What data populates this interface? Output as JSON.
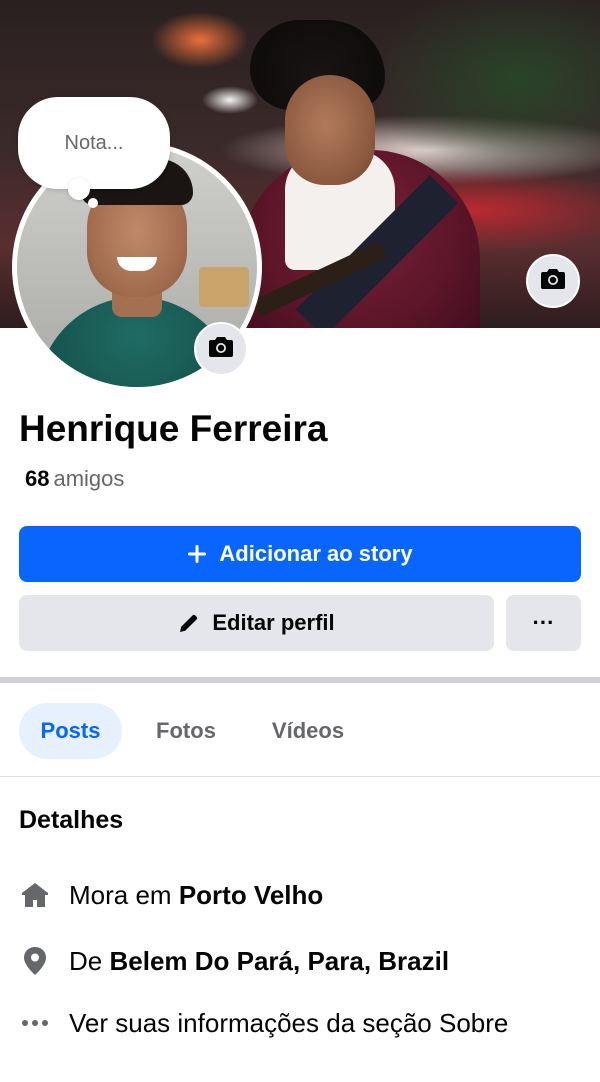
{
  "cover": {
    "camera_icon": "camera-icon"
  },
  "note": {
    "placeholder": "Nota..."
  },
  "profile": {
    "name": "Henrique Ferreira",
    "friends_count": "68",
    "friends_label": "amigos"
  },
  "actions": {
    "add_story_label": "Adicionar ao story",
    "edit_profile_label": "Editar perfil",
    "more_label": "···"
  },
  "tabs": [
    {
      "label": "Posts",
      "active": true
    },
    {
      "label": "Fotos",
      "active": false
    },
    {
      "label": "Vídeos",
      "active": false
    }
  ],
  "details": {
    "title": "Detalhes",
    "lives_prefix": "Mora em",
    "lives_city": "Porto Velho",
    "from_prefix": "De",
    "from_place": "Belem Do Pará, Para, Brazil",
    "about_link": "Ver suas informações da seção Sobre"
  },
  "colors": {
    "primary": "#0866ff",
    "secondary_bg": "#e4e6eb",
    "muted_text": "#65676b",
    "active_tab_bg": "#e7f0fd"
  }
}
